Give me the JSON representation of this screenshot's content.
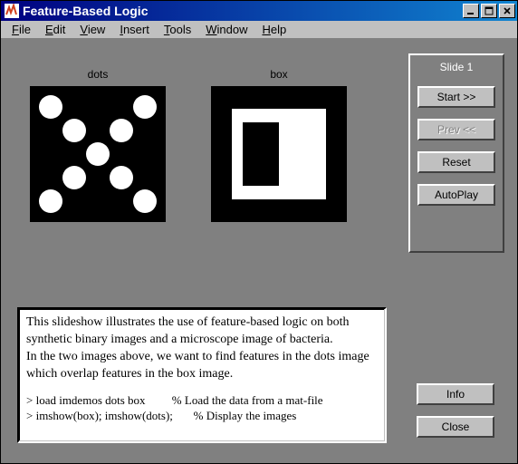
{
  "titlebar": {
    "title": "Feature-Based Logic"
  },
  "menubar": {
    "items": [
      {
        "label": "File",
        "accel": "F"
      },
      {
        "label": "Edit",
        "accel": "E"
      },
      {
        "label": "View",
        "accel": "V"
      },
      {
        "label": "Insert",
        "accel": "I"
      },
      {
        "label": "Tools",
        "accel": "T"
      },
      {
        "label": "Window",
        "accel": "W"
      },
      {
        "label": "Help",
        "accel": "H"
      }
    ]
  },
  "images": {
    "left_label": "dots",
    "right_label": "box"
  },
  "text_panel": {
    "para1": "This slideshow illustrates the use of feature-based logic on both synthetic binary images and a microscope image of bacteria.",
    "para2": "In the two images above, we want to find features in the dots image which overlap features in the box image.",
    "code1": "> load imdemos dots box         % Load the data from a mat-file",
    "code2": "> imshow(box); imshow(dots);       % Display the images"
  },
  "side_panel": {
    "slide_label": "Slide 1",
    "start": "Start >>",
    "prev": "Prev <<",
    "reset": "Reset",
    "autoplay": "AutoPlay"
  },
  "bottom_buttons": {
    "info": "Info",
    "close": "Close"
  }
}
